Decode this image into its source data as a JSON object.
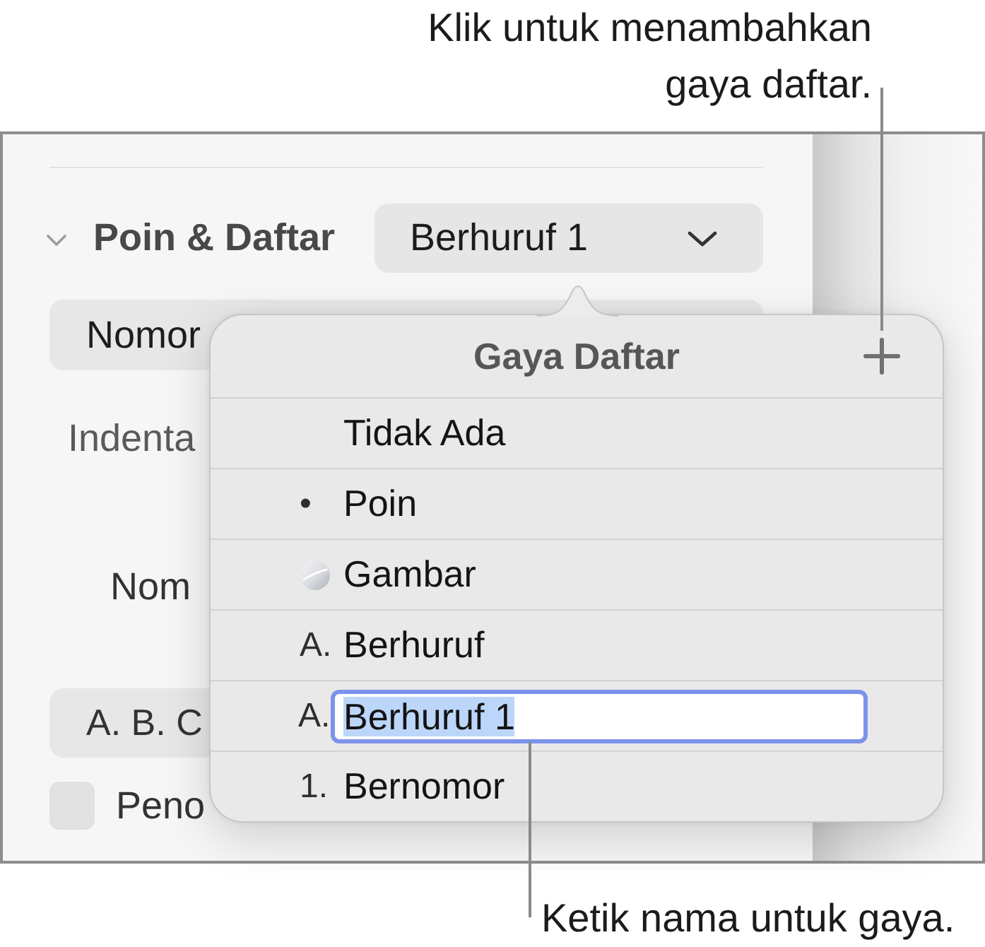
{
  "add_style_callout": "Klik untuk menambahkan gaya daftar.",
  "panel": {
    "section": {
      "title": "Poin & Daftar",
      "expanded": true
    },
    "style_popup": {
      "value": "Berhuruf 1"
    },
    "type_field": {
      "value": "Nomor"
    },
    "indent_label": "Indenta",
    "numbering_label": "Nom",
    "format_field": {
      "value": "A. B. C"
    },
    "tiered_numbering": {
      "label": "Peno",
      "checked": false
    }
  },
  "popover": {
    "title": "Gaya Daftar",
    "rows": [
      {
        "kind": "item",
        "label": "Tidak Ada"
      },
      {
        "kind": "item",
        "marker": {
          "kind": "text",
          "text": "•"
        },
        "label": "Poin"
      },
      {
        "kind": "item",
        "marker": {
          "kind": "image"
        },
        "label": "Gambar"
      },
      {
        "kind": "item",
        "marker": {
          "kind": "text",
          "text": "A."
        },
        "label": "Berhuruf"
      },
      {
        "kind": "edit",
        "marker": {
          "kind": "text",
          "text": "A."
        },
        "value": "Berhuruf 1",
        "value_selected": true
      },
      {
        "kind": "item",
        "marker": {
          "kind": "text",
          "text": "1."
        },
        "label": "Bernomor"
      }
    ]
  },
  "type_name_callout": "Ketik nama untuk gaya."
}
